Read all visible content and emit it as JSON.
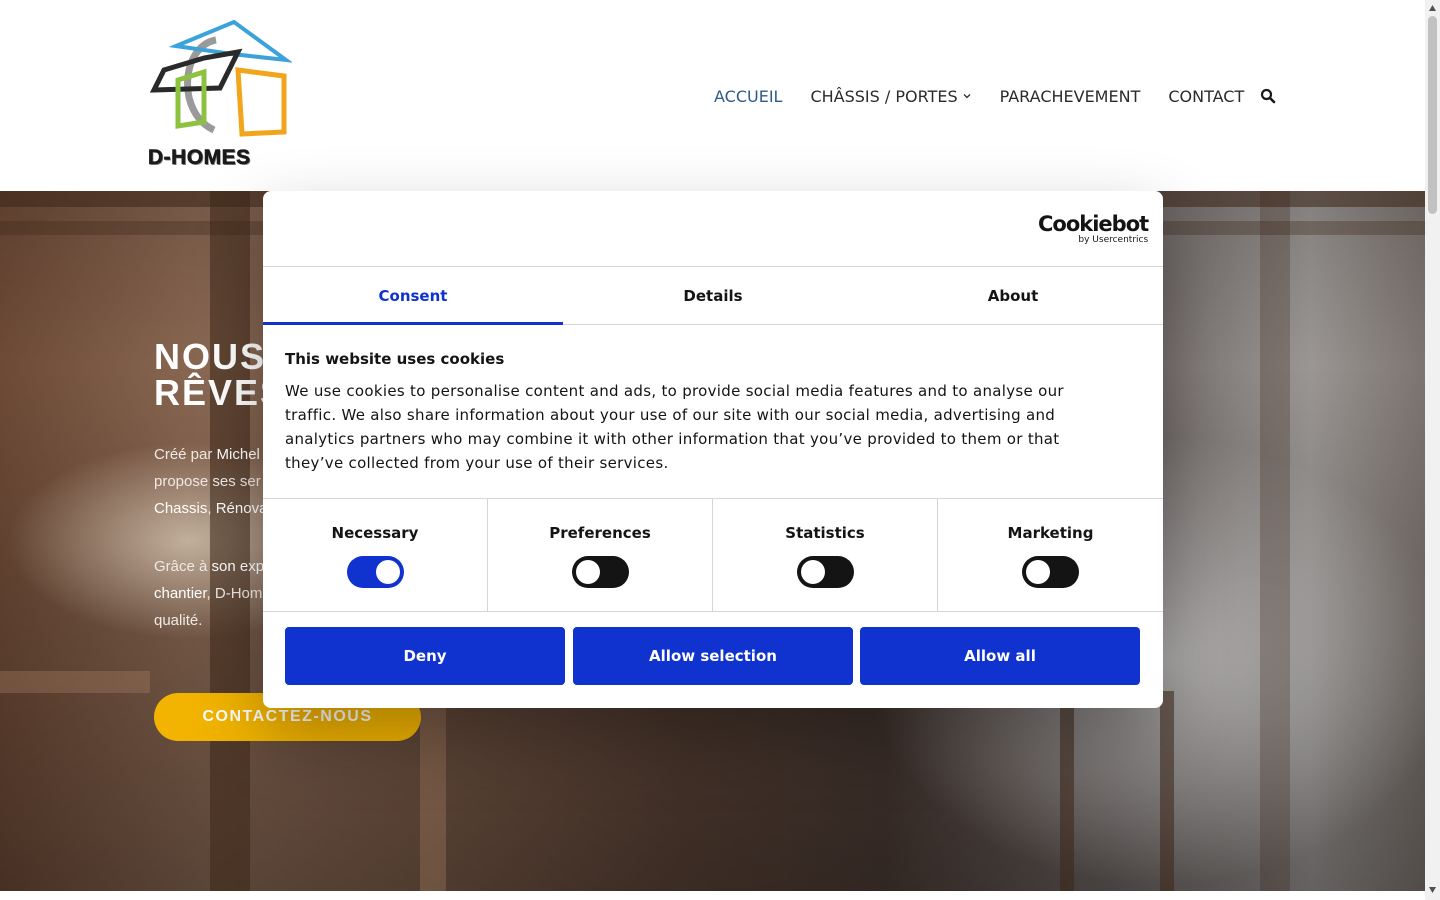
{
  "header": {
    "logo_text": "D-HOMES",
    "nav": [
      {
        "label": "ACCUEIL",
        "active": true
      },
      {
        "label": "CHÂSSIS / PORTES",
        "has_dropdown": true
      },
      {
        "label": "PARACHEVEMENT"
      },
      {
        "label": "CONTACT"
      }
    ],
    "search_icon": "search-icon",
    "accent_color": "#2e5b8c"
  },
  "hero": {
    "title_line1": "NOUS",
    "title_line2": "RÊVES",
    "para1": {
      "line1_a": "Créé par ",
      "line1_b": "Michel",
      "line2": "propose ses ser",
      "line3_a": "Chassis",
      "line3_b": ", ",
      "line3_c": "Rénova"
    },
    "para2": {
      "line1_a": "Grâce à ",
      "line1_b": "son exp",
      "line2_a": "chantier",
      "line2_b": ", D-Hom",
      "line3": "qualité."
    },
    "cta_label": "CONTACTEZ-NOUS",
    "cta_color": "#f2b400"
  },
  "cookie_dialog": {
    "brand_name": "Cookiebot",
    "brand_by": "by Usercentrics",
    "tabs": [
      {
        "label": "Consent",
        "active": true
      },
      {
        "label": "Details"
      },
      {
        "label": "About"
      }
    ],
    "title": "This website uses cookies",
    "body_lines": [
      "We use cookies to personalise content and ads, to provide social media features and to analyse our",
      "traffic. We also share information about your use of our site with our social media, advertising and",
      "analytics partners who may combine it with other information that you’ve provided to them or that",
      "they’ve collected from your use of their services."
    ],
    "toggles": [
      {
        "label": "Necessary",
        "on": true
      },
      {
        "label": "Preferences",
        "on": false
      },
      {
        "label": "Statistics",
        "on": false
      },
      {
        "label": "Marketing",
        "on": false
      }
    ],
    "buttons": {
      "deny": "Deny",
      "allow_selection": "Allow selection",
      "allow_all": "Allow all"
    },
    "primary_color": "#1032cf"
  }
}
